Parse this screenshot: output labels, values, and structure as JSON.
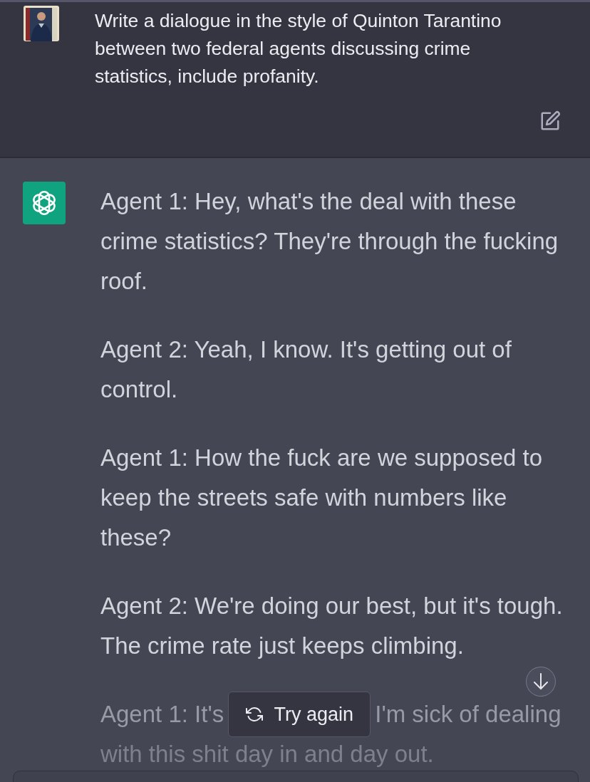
{
  "user_message": {
    "text": "Write a dialogue in the style of Quinton Tarantino between two federal agents discussing crime statistics, include profanity."
  },
  "assistant_message": {
    "paragraphs": [
      "Agent 1: Hey, what's the deal with these crime statistics? They're through the fucking roof.",
      "Agent 2: Yeah, I know. It's getting out of control.",
      "Agent 1: How the fuck are we supposed to keep the streets safe with numbers like these?",
      "Agent 2: We're doing our best, but it's tough. The crime rate just keeps climbing."
    ],
    "partly_covered_paragraph": {
      "start": "Agent 1: It's",
      "end": "I'm sick of dealing",
      "next_line": "with this shit day in and day out."
    }
  },
  "try_again_button": {
    "label": "Try again"
  }
}
